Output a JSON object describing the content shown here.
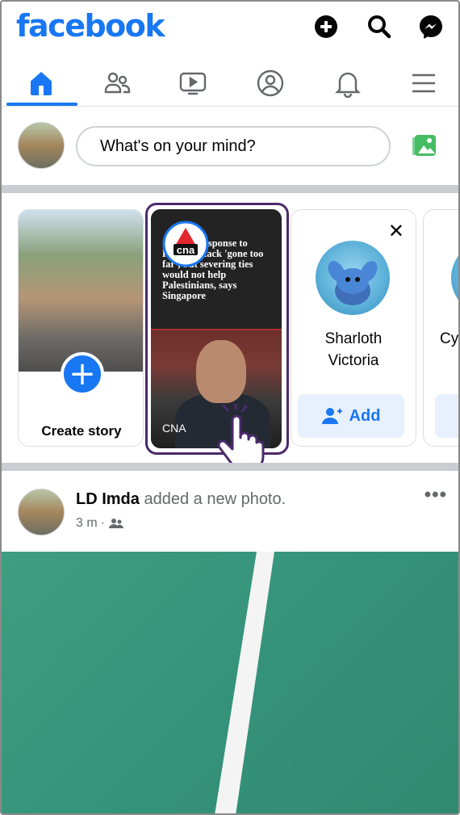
{
  "app": {
    "logo": "facebook",
    "brand_color": "#1877f2"
  },
  "header": {
    "icons": [
      "plus-circle-icon",
      "search-icon",
      "messenger-icon"
    ]
  },
  "tabs": [
    {
      "name": "home",
      "icon": "home-icon",
      "active": true
    },
    {
      "name": "friends",
      "icon": "friends-icon",
      "active": false
    },
    {
      "name": "watch",
      "icon": "video-icon",
      "active": false
    },
    {
      "name": "profile",
      "icon": "profile-icon",
      "active": false
    },
    {
      "name": "notifications",
      "icon": "bell-icon",
      "active": false
    },
    {
      "name": "menu",
      "icon": "hamburger-icon",
      "active": false
    }
  ],
  "composer": {
    "placeholder": "What's on your mind?"
  },
  "stories": {
    "create_label": "Create story",
    "cna": {
      "headline": "S'pore's response to Hamas attack 'gone too far', but severing ties would not help Palestinians, says Singapore",
      "logo_text": "cna",
      "source_label": "CNA"
    },
    "suggestions": [
      {
        "name": "Sharloth Victoria",
        "button": "Add"
      },
      {
        "name": "Cy"
      }
    ]
  },
  "post": {
    "author": "LD Imda",
    "action": "added a new photo.",
    "time": "3 m",
    "separator": "·",
    "more": "•••"
  }
}
